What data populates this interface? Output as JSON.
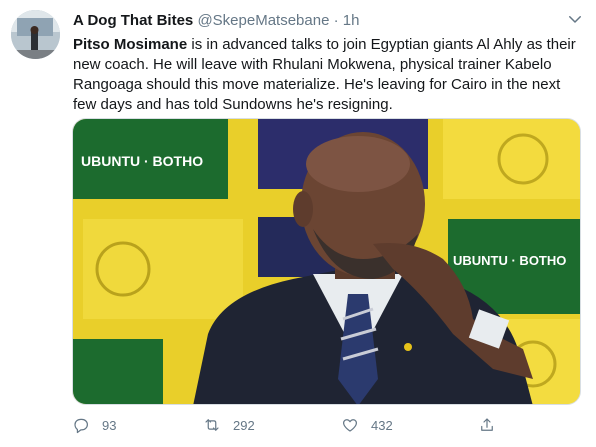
{
  "tweet": {
    "display_name": "A Dog That Bites",
    "handle": "@SkepeMatsebane",
    "separator": "·",
    "time": "1h",
    "text_bold": "Pitso Mosimane",
    "text_rest": " is in advanced talks to join Egyptian giants Al Ahly as their new coach. He will leave with Rhulani Mokwena, physical trainer Kabelo Rangoaga should this move materialize. He's leaving for Cairo in the next few days and has told Sundowns he's resigning.",
    "photo_banner_text": "UBUNTU · BOTHO",
    "actions": {
      "reply_count": "93",
      "retweet_count": "292",
      "like_count": "432"
    }
  },
  "icons": {
    "reply": "comment-icon",
    "retweet": "retweet-icon",
    "like": "heart-icon",
    "share": "share-icon",
    "menu": "chevron-down-icon"
  },
  "colors": {
    "text": "#14171a",
    "muted": "#657786",
    "banner_green": "#1c6b2e",
    "banner_yellow": "#f1d814"
  }
}
